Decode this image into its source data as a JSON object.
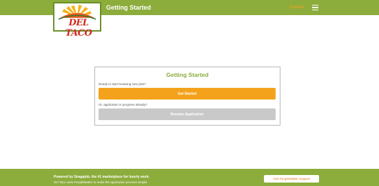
{
  "header": {
    "logo_text": "DEL TACO",
    "title": "Getting Started",
    "language": "Español"
  },
  "card": {
    "title": "Getting Started",
    "start_prompt": "Ready to start browsing new jobs?",
    "start_button": "Get Started",
    "resume_prompt": "Or, application in progress already?",
    "resume_button": "Resume Application"
  },
  "footer": {
    "line1": "Powered by Snagajob, the #1 marketplace for hourly work.",
    "line2": "Del Taco uses PeopleMatter to make the application process simple.",
    "support_button": "Visit PeopleMatter Support"
  },
  "colors": {
    "brand_green": "#8cac3c",
    "accent_orange": "#f4a21c",
    "disabled_gray": "#c9c9c9",
    "logo_red": "#cf2b1f"
  }
}
